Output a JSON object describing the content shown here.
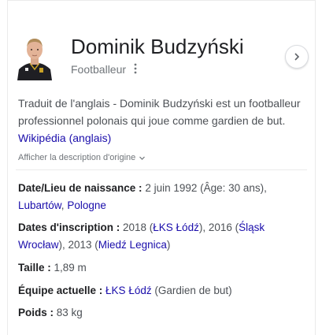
{
  "header": {
    "title": "Dominik Budzyński",
    "subtitle": "Footballeur",
    "more_icon": "more-vert-icon",
    "next_icon": "chevron-right-icon"
  },
  "description": {
    "text": "Traduit de l'anglais - Dominik Budzyński est un footballeur professionnel polonais qui joue comme gardien de but.",
    "source_link": "Wikipédia (anglais)",
    "show_original": "Afficher la description d'origine"
  },
  "facts": {
    "birth": {
      "label": "Date/Lieu de naissance :",
      "value": "2 juin 1992 (Âge: 30 ans),",
      "place1": "Lubartów",
      "sep": ",",
      "place2": "Pologne"
    },
    "signing": {
      "label": "Dates d'inscription :",
      "v1": "2018 (",
      "l1": "ŁKS Łódź",
      "v2": "), 2016 (",
      "l2": "Śląsk Wrocław",
      "v3": "), 2013 (",
      "l3": "Miedź Legnica",
      "v4": ")"
    },
    "height": {
      "label": "Taille :",
      "value": "1,89 m"
    },
    "team": {
      "label": "Équipe actuelle :",
      "link": "ŁKS Łódź",
      "value": "(Gardien de but)"
    },
    "weight": {
      "label": "Poids :",
      "value": "83 kg"
    }
  },
  "colors": {
    "link": "#1a0dab",
    "text": "#4d5156",
    "heading": "#202124",
    "muted": "#70757a"
  }
}
